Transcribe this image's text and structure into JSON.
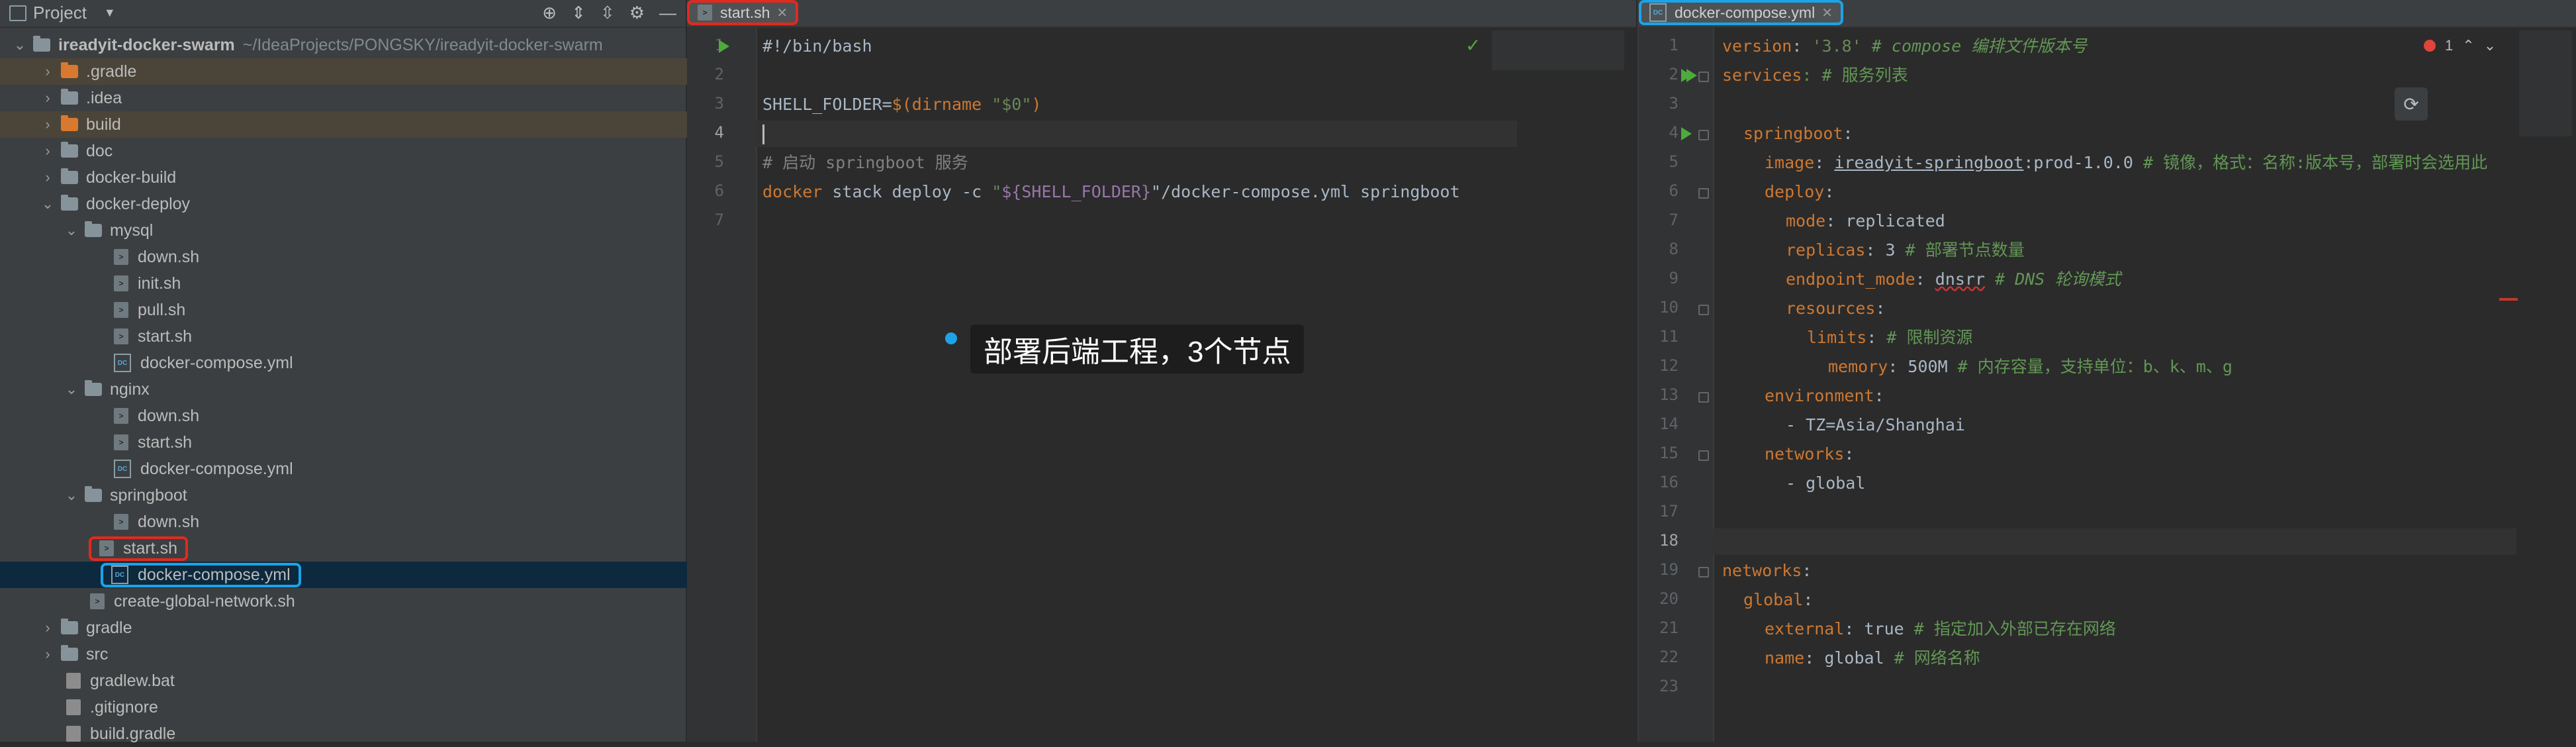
{
  "project_panel": {
    "title": "Project",
    "tree": [
      {
        "label": "ireadyit-docker-swarm",
        "path": "~/IdeaProjects/PONGSKY/ireadyit-docker-swarm",
        "type": "root"
      },
      {
        "label": ".gradle",
        "type": "folder-orange"
      },
      {
        "label": ".idea",
        "type": "folder"
      },
      {
        "label": "build",
        "type": "folder-orange"
      },
      {
        "label": "doc",
        "type": "folder"
      },
      {
        "label": "docker-build",
        "type": "folder"
      },
      {
        "label": "docker-deploy",
        "type": "folder"
      },
      {
        "label": "mysql",
        "type": "folder"
      },
      {
        "label": "down.sh",
        "type": "sh"
      },
      {
        "label": "init.sh",
        "type": "sh"
      },
      {
        "label": "pull.sh",
        "type": "sh"
      },
      {
        "label": "start.sh",
        "type": "sh"
      },
      {
        "label": "docker-compose.yml",
        "type": "yml"
      },
      {
        "label": "nginx",
        "type": "folder"
      },
      {
        "label": "down.sh",
        "type": "sh"
      },
      {
        "label": "start.sh",
        "type": "sh"
      },
      {
        "label": "docker-compose.yml",
        "type": "yml"
      },
      {
        "label": "springboot",
        "type": "folder"
      },
      {
        "label": "down.sh",
        "type": "sh"
      },
      {
        "label": "start.sh",
        "type": "sh"
      },
      {
        "label": "docker-compose.yml",
        "type": "yml"
      },
      {
        "label": "create-global-network.sh",
        "type": "sh"
      },
      {
        "label": "gradle",
        "type": "folder"
      },
      {
        "label": "src",
        "type": "folder"
      },
      {
        "label": "gradlew.bat",
        "type": "gen"
      },
      {
        "label": ".gitignore",
        "type": "gen"
      },
      {
        "label": "build.gradle",
        "type": "gen"
      }
    ]
  },
  "left_editor": {
    "tab_label": "start.sh",
    "line_numbers": [
      "1",
      "2",
      "3",
      "4",
      "5",
      "6",
      "7"
    ],
    "lines": {
      "l1": "#!/bin/bash",
      "l3_a": "SHELL_FOLDER=",
      "l3_b": "$(",
      "l3_c": "dirname ",
      "l3_d": "\"$0\"",
      "l3_e": ")",
      "l5": "# 启动 springboot 服务",
      "l6_a": "docker",
      "l6_b": " stack deploy -c ",
      "l6_c": "\"",
      "l6_d": "${SHELL_FOLDER}",
      "l6_e": "\"/docker-compose.yml springboot"
    }
  },
  "tooltip": {
    "text": "部署后端工程，3个节点"
  },
  "right_editor": {
    "tab_label": "docker-compose.yml",
    "problem_count": "1",
    "line_numbers": [
      "1",
      "2",
      "3",
      "4",
      "5",
      "6",
      "7",
      "8",
      "9",
      "10",
      "11",
      "12",
      "13",
      "14",
      "15",
      "16",
      "17",
      "18",
      "19",
      "20",
      "21",
      "22",
      "23"
    ],
    "lines": {
      "l1_a": "version",
      "l1_b": ": ",
      "l1_c": "'3.8'",
      "l1_d": " # compose 编排文件版本号",
      "l2_a": "services",
      "l2_b": ": # 服务列表",
      "l4_a": "springboot",
      "l4_b": ":",
      "l5_a": "image",
      "l5_b": ": ",
      "l5_c": "ireadyit-springboot",
      "l5_d": ":prod-1.0.0 ",
      "l5_e": "# 镜像，格式：名称:版本号，部署时会选用此",
      "l6_a": "deploy",
      "l6_b": ":",
      "l7_a": "mode",
      "l7_b": ": replicated",
      "l8_a": "replicas",
      "l8_b": ": 3 ",
      "l8_c": "# 部署节点数量",
      "l9_a": "endpoint_mode",
      "l9_b": ": ",
      "l9_c": "dnsrr",
      "l9_d": " # DNS 轮询模式",
      "l10_a": "resources",
      "l10_b": ":",
      "l11_a": "limits",
      "l11_b": ": ",
      "l11_c": "# 限制资源",
      "l12_a": "memory",
      "l12_b": ": 500M ",
      "l12_c": "# 内存容量，支持单位：b、k、m、g",
      "l13_a": "environment",
      "l13_b": ":",
      "l14": "- TZ=Asia/Shanghai",
      "l15_a": "networks",
      "l15_b": ":",
      "l16": "- global",
      "l19_a": "networks",
      "l19_b": ":",
      "l20_a": "global",
      "l20_b": ":",
      "l21_a": "external",
      "l21_b": ": true ",
      "l21_c": "# 指定加入外部已存在网络",
      "l22_a": "name",
      "l22_b": ": global ",
      "l22_c": "# 网络名称"
    }
  },
  "colors": {
    "accent_red": "#e02a1f",
    "accent_blue": "#1ca3e8",
    "selection": "#0d293e"
  }
}
